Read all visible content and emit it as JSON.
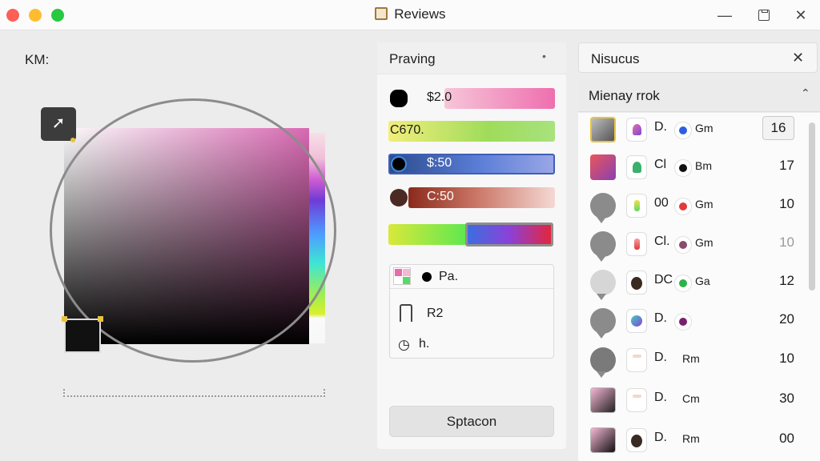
{
  "window": {
    "title": "Reviews"
  },
  "canvas": {
    "label": "KM:"
  },
  "mid_panel": {
    "title": "Praving",
    "rows": [
      {
        "label": "$2.0"
      },
      {
        "label": "C670."
      },
      {
        "label": "$:50"
      },
      {
        "label": "C:50"
      }
    ],
    "box": {
      "row1": "Pa.",
      "row2": "R2",
      "row3": "h."
    },
    "save_label": "Sptacon"
  },
  "right_panel": {
    "title": "Nisucus",
    "subheader": "Mienay rrok",
    "items": [
      {
        "l1": "D.",
        "l2": "Gm",
        "num": "16"
      },
      {
        "l1": "Cl",
        "l2": "Bm",
        "num": "17"
      },
      {
        "l1": "00",
        "l2": "Gm",
        "num": "10"
      },
      {
        "l1": "Cl.",
        "l2": "Gm",
        "num": "10"
      },
      {
        "l1": "DC",
        "l2": "Ga",
        "num": "12"
      },
      {
        "l1": "D.",
        "l2": "",
        "num": "20"
      },
      {
        "l1": "D.",
        "l2": "Rm",
        "num": "10"
      },
      {
        "l1": "D.",
        "l2": "Cm",
        "num": "30"
      },
      {
        "l1": "D.",
        "l2": "Rm",
        "num": "00"
      }
    ]
  },
  "colors": {
    "accent_pink": "#e96ca8",
    "accent_blue": "#5b7ed8",
    "accent_red": "#e03a3a"
  },
  "icons": [
    "cursor-icon",
    "minimize-icon",
    "maximize-icon",
    "close-icon",
    "chevron-up-icon",
    "heart-icon",
    "clock-icon"
  ]
}
